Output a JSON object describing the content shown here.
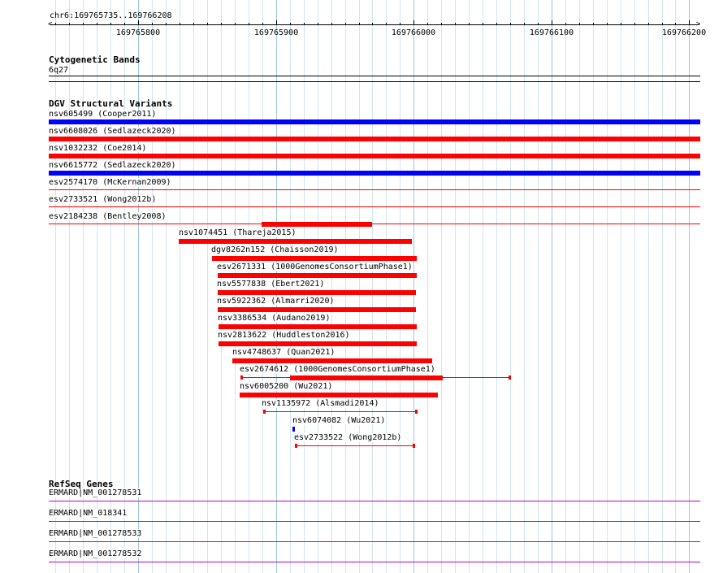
{
  "ruler": {
    "location": "chr6:169765735..169766208",
    "ticks": [
      "169765800",
      "169765900",
      "169766000",
      "169766100",
      "169766200"
    ]
  },
  "cytoband_track": {
    "title": "Cytogenetic Bands",
    "band": "6q27"
  },
  "dgv_track": {
    "title": "DGV Structural Variants",
    "full_width_rows": [
      {
        "label": "nsv605499 (Cooper2011)",
        "color": "#0000ff",
        "style": "thick"
      },
      {
        "label": "nsv6608026 (Sedlazeck2020)",
        "color": "#ff0000",
        "style": "thick"
      },
      {
        "label": "nsv1032232 (Coe2014)",
        "color": "#ff0000",
        "style": "thick"
      },
      {
        "label": "nsv6615772 (Sedlazeck2020)",
        "color": "#0000ff",
        "style": "thick"
      },
      {
        "label": "esv2574170 (McKernan2009)",
        "color": "#ff0000",
        "style": "thin"
      },
      {
        "label": "esv2733521 (Wong2012b)",
        "color": "#ff0000",
        "style": "thin"
      },
      {
        "label": "esv2184238 (Bentley2008)",
        "color": "#ff0000",
        "style": "thin"
      }
    ],
    "features": [
      {
        "label": "nsv1074451 (Thareja2015)",
        "color": "#ff0000",
        "style": "thick"
      },
      {
        "label": "dgv8262n152 (Chaisson2019)",
        "color": "#ff0000",
        "style": "thick"
      },
      {
        "label": "esv2671331 (1000GenomesConsortiumPhase1)",
        "color": "#ff0000",
        "style": "thick"
      },
      {
        "label": "nsv5577838 (Ebert2021)",
        "color": "#ff0000",
        "style": "thick"
      },
      {
        "label": "nsv5922362 (Almarri2020)",
        "color": "#ff0000",
        "style": "thick"
      },
      {
        "label": "nsv3386534 (Audano2019)",
        "color": "#ff0000",
        "style": "thick"
      },
      {
        "label": "nsv2813622 (Huddleston2016)",
        "color": "#ff0000",
        "style": "thick"
      },
      {
        "label": "nsv4748637 (Quan2021)",
        "color": "#ff0000",
        "style": "thick"
      },
      {
        "label": "esv2674612 (1000GenomesConsortiumPhase1)",
        "color": "#ff0000",
        "style": "mixed"
      },
      {
        "label": "nsv6005200 (Wu2021)",
        "color": "#ff0000",
        "style": "thick"
      },
      {
        "label": "nsv1135972 (Alsmadi2014)",
        "color": "#ff0000",
        "style": "thin"
      },
      {
        "label": "nsv6074082 (Wu2021)",
        "color": "#0000ff",
        "style": "thick"
      },
      {
        "label": "esv2733522 (Wong2012b)",
        "color": "#ff0000",
        "style": "thin"
      }
    ]
  },
  "refseq_track": {
    "title": "RefSeq Genes",
    "genes": [
      {
        "label": "ERMARD|NM_001278531"
      },
      {
        "label": "ERMARD|NM_018341"
      },
      {
        "label": "ERMARD|NM_001278533"
      },
      {
        "label": "ERMARD|NM_001278532"
      }
    ]
  }
}
